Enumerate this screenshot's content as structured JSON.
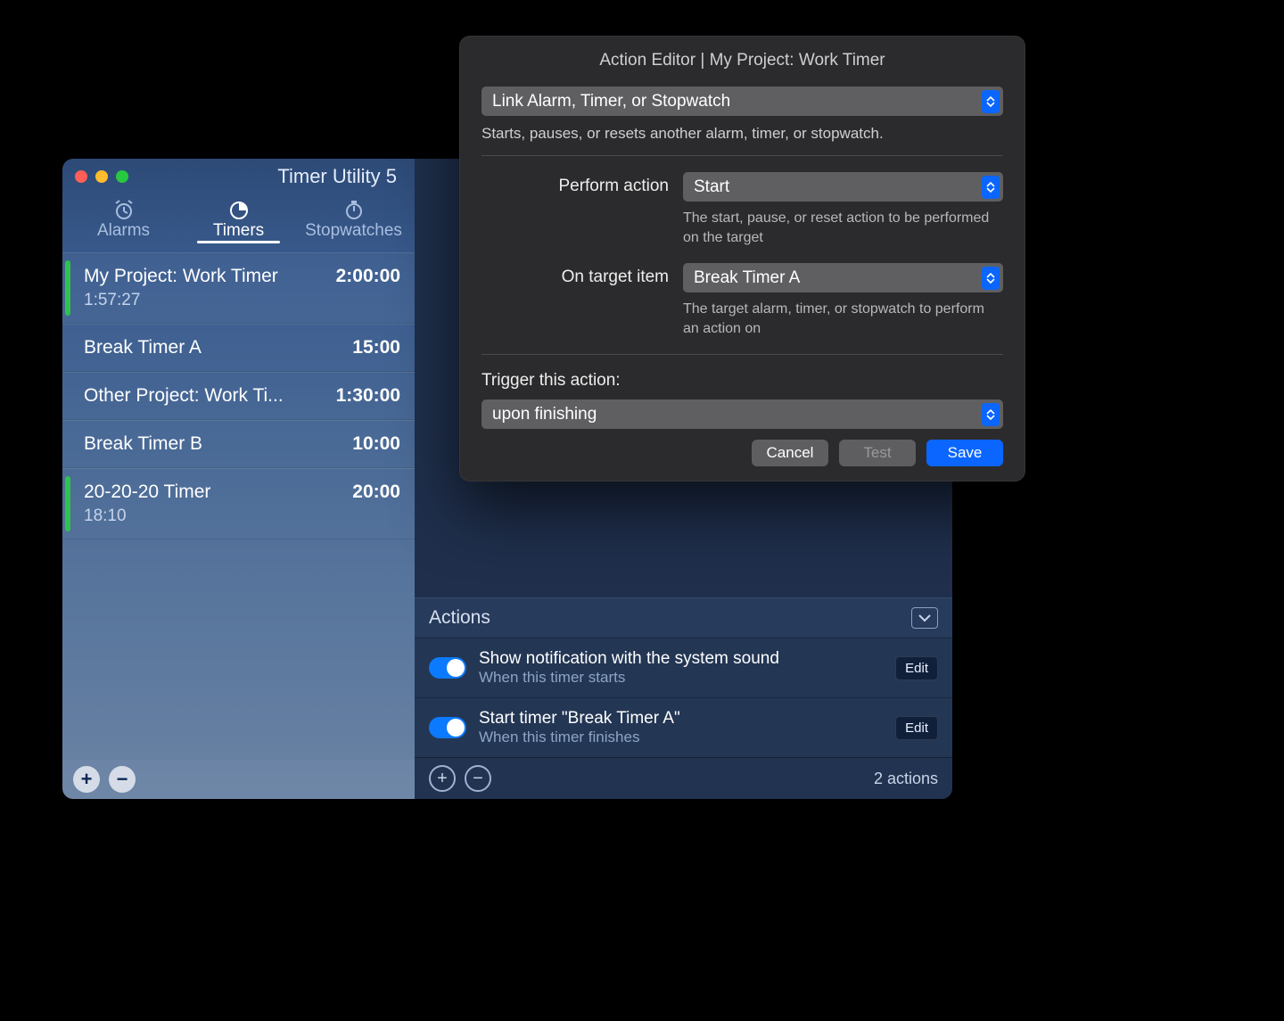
{
  "app": {
    "title": "Timer Utility 5"
  },
  "tabs": {
    "alarms": "Alarms",
    "timers": "Timers",
    "stopwatches": "Stopwatches",
    "active": "timers"
  },
  "timers": [
    {
      "name": "My Project: Work Timer",
      "duration": "2:00:00",
      "sub": "1:57:27",
      "active": true
    },
    {
      "name": "Break Timer A",
      "duration": "15:00",
      "sub": ""
    },
    {
      "name": "Other Project: Work Ti...",
      "duration": "1:30:00",
      "sub": ""
    },
    {
      "name": "Break Timer B",
      "duration": "10:00",
      "sub": ""
    },
    {
      "name": "20-20-20 Timer",
      "duration": "20:00",
      "sub": "18:10",
      "green": true
    }
  ],
  "actions": {
    "header": "Actions",
    "items": [
      {
        "title": "Show notification with the system sound",
        "sub": "When this timer starts",
        "edit": "Edit"
      },
      {
        "title": "Start timer \"Break Timer A\"",
        "sub": "When this timer finishes",
        "edit": "Edit"
      }
    ],
    "count_label": "2 actions"
  },
  "editor": {
    "title": "Action Editor | My Project: Work Timer",
    "type_select": "Link Alarm, Timer, or Stopwatch",
    "type_desc": "Starts, pauses, or resets another alarm, timer, or stopwatch.",
    "perform_label": "Perform action",
    "perform_value": "Start",
    "perform_desc": "The start, pause, or reset action to be performed on the target",
    "target_label": "On target item",
    "target_value": "Break Timer A",
    "target_desc": "The target alarm, timer, or stopwatch to perform an action on",
    "trigger_label": "Trigger this action:",
    "trigger_value": "upon finishing",
    "cancel": "Cancel",
    "test": "Test",
    "save": "Save"
  }
}
